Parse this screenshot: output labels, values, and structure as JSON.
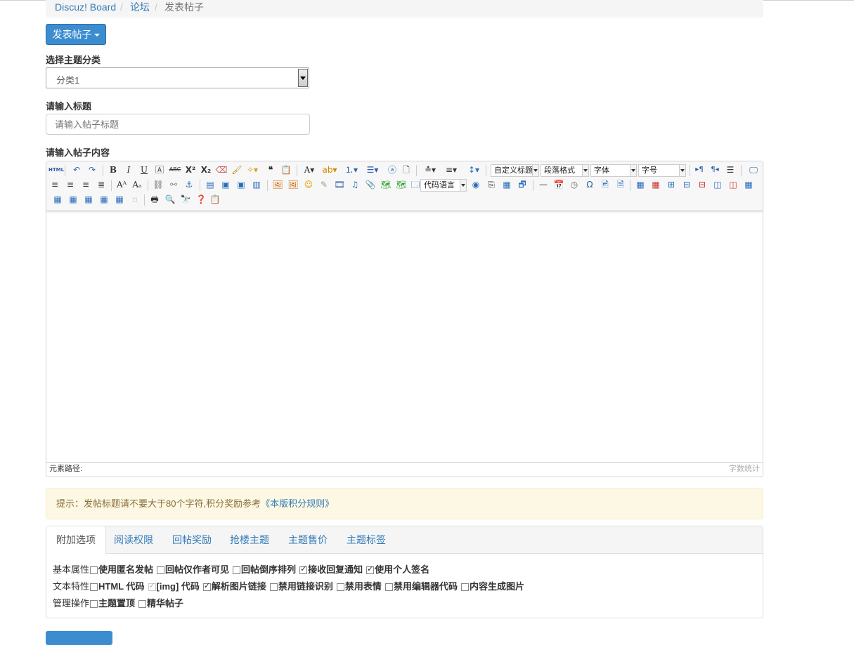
{
  "breadcrumb": {
    "home": "Discuz! Board",
    "forum": "论坛",
    "current": "发表帖子",
    "sep": "/"
  },
  "post_button": "发表帖子",
  "category": {
    "label": "选择主题分类",
    "value": "分类1"
  },
  "title_field": {
    "label": "请输入标题",
    "placeholder": "请输入帖子标题"
  },
  "content": {
    "label": "请输入帖子内容"
  },
  "toolbar": {
    "combos": {
      "custom_title": "自定义标题",
      "paragraph": "段落格式",
      "font": "字体",
      "font_size": "字号",
      "code_lang": "代码语言"
    }
  },
  "status": {
    "path": "元素路径:",
    "wordcount": "字数统计"
  },
  "alert": {
    "text": "提示：发帖标题请不要大于80个字符,积分奖励参考",
    "link": "《本版积分规则》"
  },
  "tabs": [
    "附加选项",
    "阅读权限",
    "回帖奖励",
    "抢楼主题",
    "主题售价",
    "主题标签"
  ],
  "options": {
    "basic": {
      "label": "基本属性",
      "items": [
        {
          "text": "使用匿名发帖",
          "checked": false
        },
        {
          "text": "回帖仅作者可见",
          "checked": false
        },
        {
          "text": "回帖倒序排列",
          "checked": false
        },
        {
          "text": "接收回复通知",
          "checked": true
        },
        {
          "text": "使用个人签名",
          "checked": true
        }
      ]
    },
    "text": {
      "label": "文本特性",
      "items": [
        {
          "text": "HTML 代码",
          "checked": false
        },
        {
          "text": "[img] 代码",
          "checked": true,
          "disabled": true
        },
        {
          "text": "解析图片链接",
          "checked": true
        },
        {
          "text": "禁用链接识别",
          "checked": false
        },
        {
          "text": "禁用表情",
          "checked": false
        },
        {
          "text": "禁用编辑器代码",
          "checked": false
        },
        {
          "text": "内容生成图片",
          "checked": false
        }
      ]
    },
    "manage": {
      "label": "管理操作",
      "items": [
        {
          "text": "主题置顶",
          "checked": false
        },
        {
          "text": "精华帖子",
          "checked": false
        }
      ]
    }
  },
  "colors": {
    "primary": "#3c8dd0",
    "link": "#337ab7",
    "alert_bg": "#fcf8e3",
    "alert_text": "#8a6d3b"
  }
}
